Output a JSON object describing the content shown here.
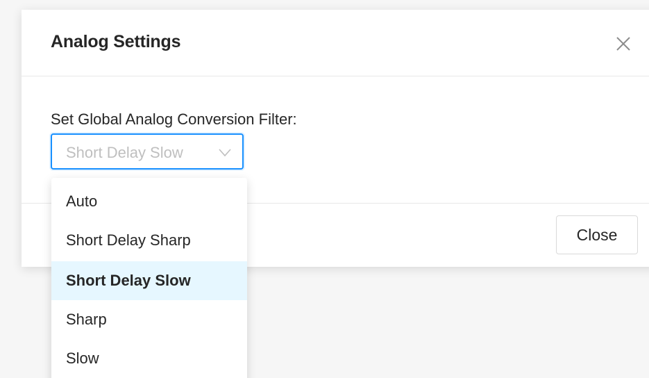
{
  "dialog": {
    "title": "Analog Settings",
    "close_icon": "close-icon",
    "close_button_label": "Close"
  },
  "filter": {
    "label": "Set Global Analog Conversion Filter:",
    "selected_value": "Short Delay Slow",
    "arrow_icon": "chevron-down-icon",
    "options": [
      {
        "label": "Auto",
        "selected": false
      },
      {
        "label": "Short Delay Sharp",
        "selected": false
      },
      {
        "label": "Short Delay Slow",
        "selected": true
      },
      {
        "label": "Sharp",
        "selected": false
      },
      {
        "label": "Slow",
        "selected": false
      }
    ]
  },
  "colors": {
    "accent": "#1890ff",
    "selected_option_bg": "#e6f7ff",
    "placeholder_text": "#bfbfbf",
    "text": "#262626"
  }
}
